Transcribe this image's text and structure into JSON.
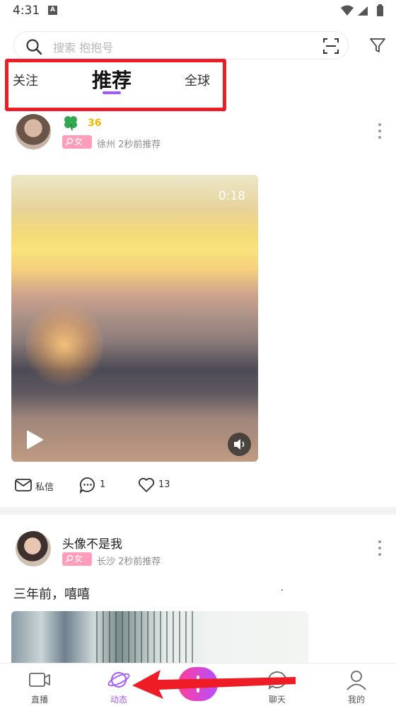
{
  "status_bar": {
    "time": "4:31",
    "indicator": "A"
  },
  "search": {
    "placeholder": "搜索 抱抱号"
  },
  "tabs": {
    "follow": "关注",
    "recommend": "推荐",
    "global": "全球",
    "active": "推荐"
  },
  "posts": [
    {
      "level": "36",
      "gender": "女",
      "location_time": "徐州   2秒前推荐",
      "video_duration": "0:18",
      "actions": {
        "message": "私信",
        "comments": "1",
        "likes": "13"
      }
    },
    {
      "username": "头像不是我",
      "gender": "女",
      "location_time": "长沙   2秒前推荐",
      "text": "三年前，嘻嘻"
    }
  ],
  "bottom_nav": {
    "live": "直播",
    "feed": "动态",
    "chat": "聊天",
    "mine": "我的",
    "active": "动态"
  },
  "colors": {
    "accent": "#a259ff",
    "highlight_box": "#ee1c25",
    "level": "#f0b800",
    "gender_badge": "#ff9dba",
    "publish_start": "#ff3d9b",
    "publish_end": "#b44fff"
  },
  "icons": [
    "search-icon",
    "scan-icon",
    "filter-icon",
    "clover-icon",
    "more-icon",
    "play-icon",
    "sound-icon",
    "mail-icon",
    "comment-icon",
    "heart-icon",
    "video-camera-icon",
    "planet-icon",
    "chat-bubble-icon",
    "person-icon"
  ]
}
